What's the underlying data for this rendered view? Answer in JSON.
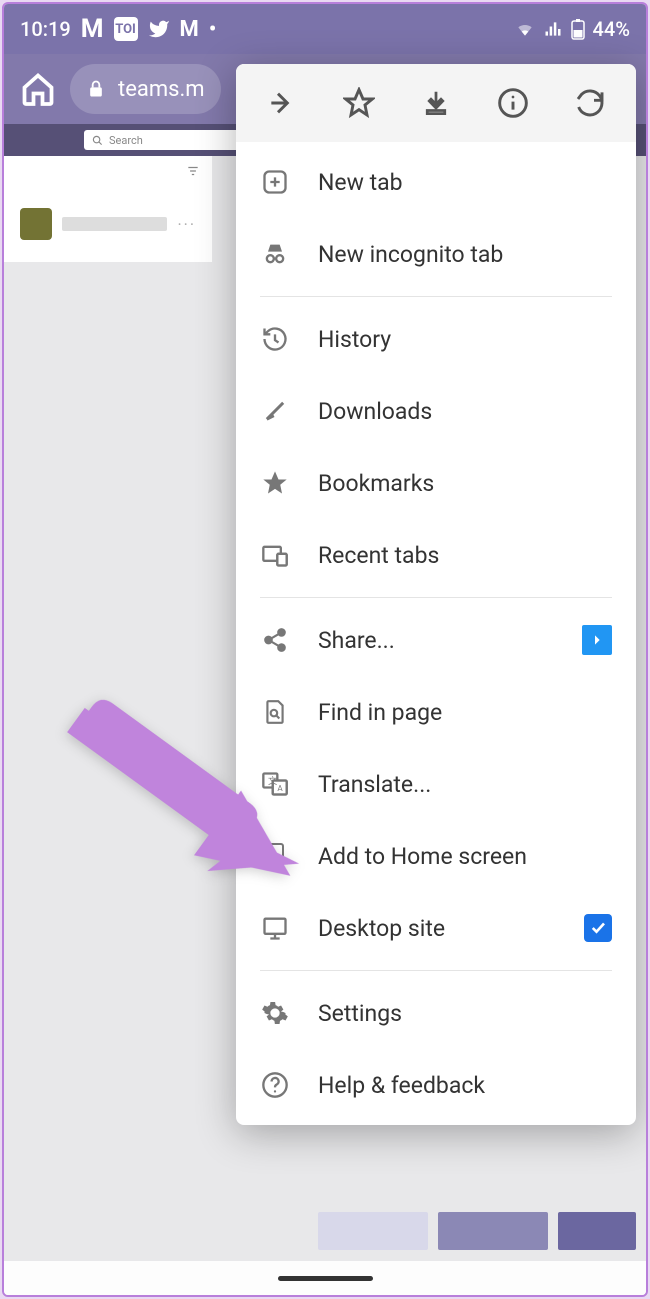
{
  "statusbar": {
    "time": "10:19",
    "battery": "44%"
  },
  "addressbar": {
    "url": "teams.m"
  },
  "teams": {
    "search_placeholder": "Search"
  },
  "menu": {
    "new_tab": "New tab",
    "incognito": "New incognito tab",
    "history": "History",
    "downloads": "Downloads",
    "bookmarks": "Bookmarks",
    "recent_tabs": "Recent tabs",
    "share": "Share...",
    "find": "Find in page",
    "translate": "Translate...",
    "add_home": "Add to Home screen",
    "desktop": "Desktop site",
    "desktop_checked": true,
    "settings": "Settings",
    "help": "Help & feedback"
  }
}
